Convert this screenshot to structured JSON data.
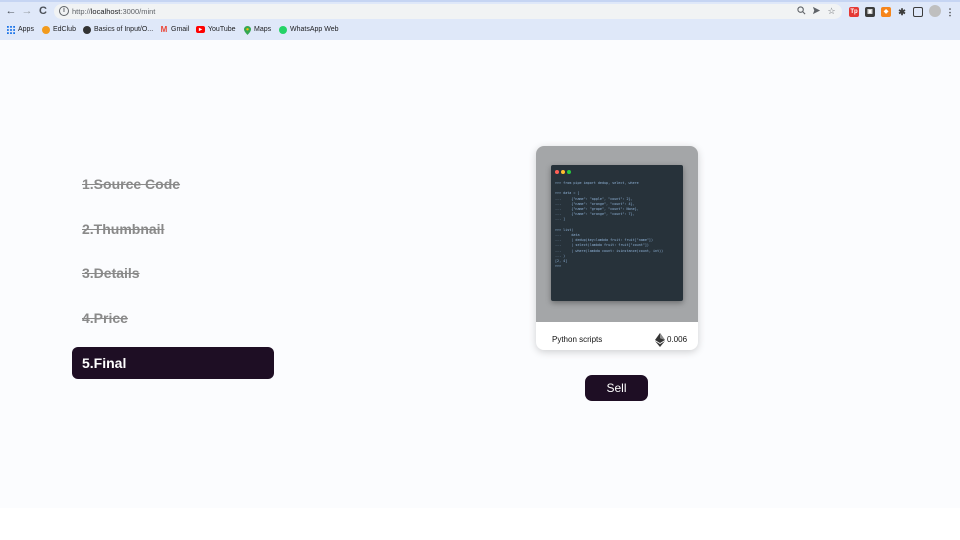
{
  "browser": {
    "url_scheme": "http://",
    "url_host": "localhost",
    "url_path": ":3000/mint",
    "nav_back": "←",
    "nav_forward": "→",
    "nav_reload": "C",
    "bookmarks": [
      {
        "label": "Apps"
      },
      {
        "label": "EdClub"
      },
      {
        "label": "Basics of Input/O..."
      },
      {
        "label": "Gmail"
      },
      {
        "label": "YouTube"
      },
      {
        "label": "Maps"
      },
      {
        "label": "WhatsApp Web"
      }
    ]
  },
  "steps": [
    {
      "label": "1.Source Code",
      "done": true
    },
    {
      "label": "2.Thumbnail",
      "done": true
    },
    {
      "label": "3.Details",
      "done": true
    },
    {
      "label": "4.Price",
      "done": true
    },
    {
      "label": "5.Final",
      "done": false
    }
  ],
  "card": {
    "title": "Python scripts",
    "price": "0.006",
    "code": ">>> from pipe import dedup, select, where\n\n>>> data = [\n...     {\"name\": \"apple\", \"count\": 2},\n...     {\"name\": \"orange\", \"count\": 4},\n...     {\"name\": \"grape\", \"count\": None},\n...     {\"name\": \"orange\", \"count\": 7},\n... ]\n\n>>> list(\n...     data\n...     | dedup(key=lambda fruit: fruit[\"name\"])\n...     | select(lambda fruit: fruit[\"count\"])\n...     | where(lambda count: isinstance(count, int))\n... )\n[2, 4]\n>>>"
  },
  "sell_label": "Sell",
  "colors": {
    "accent": "#1e0e24",
    "muted_step": "#8a8a8a",
    "page_bg": "#fbfcfe"
  }
}
